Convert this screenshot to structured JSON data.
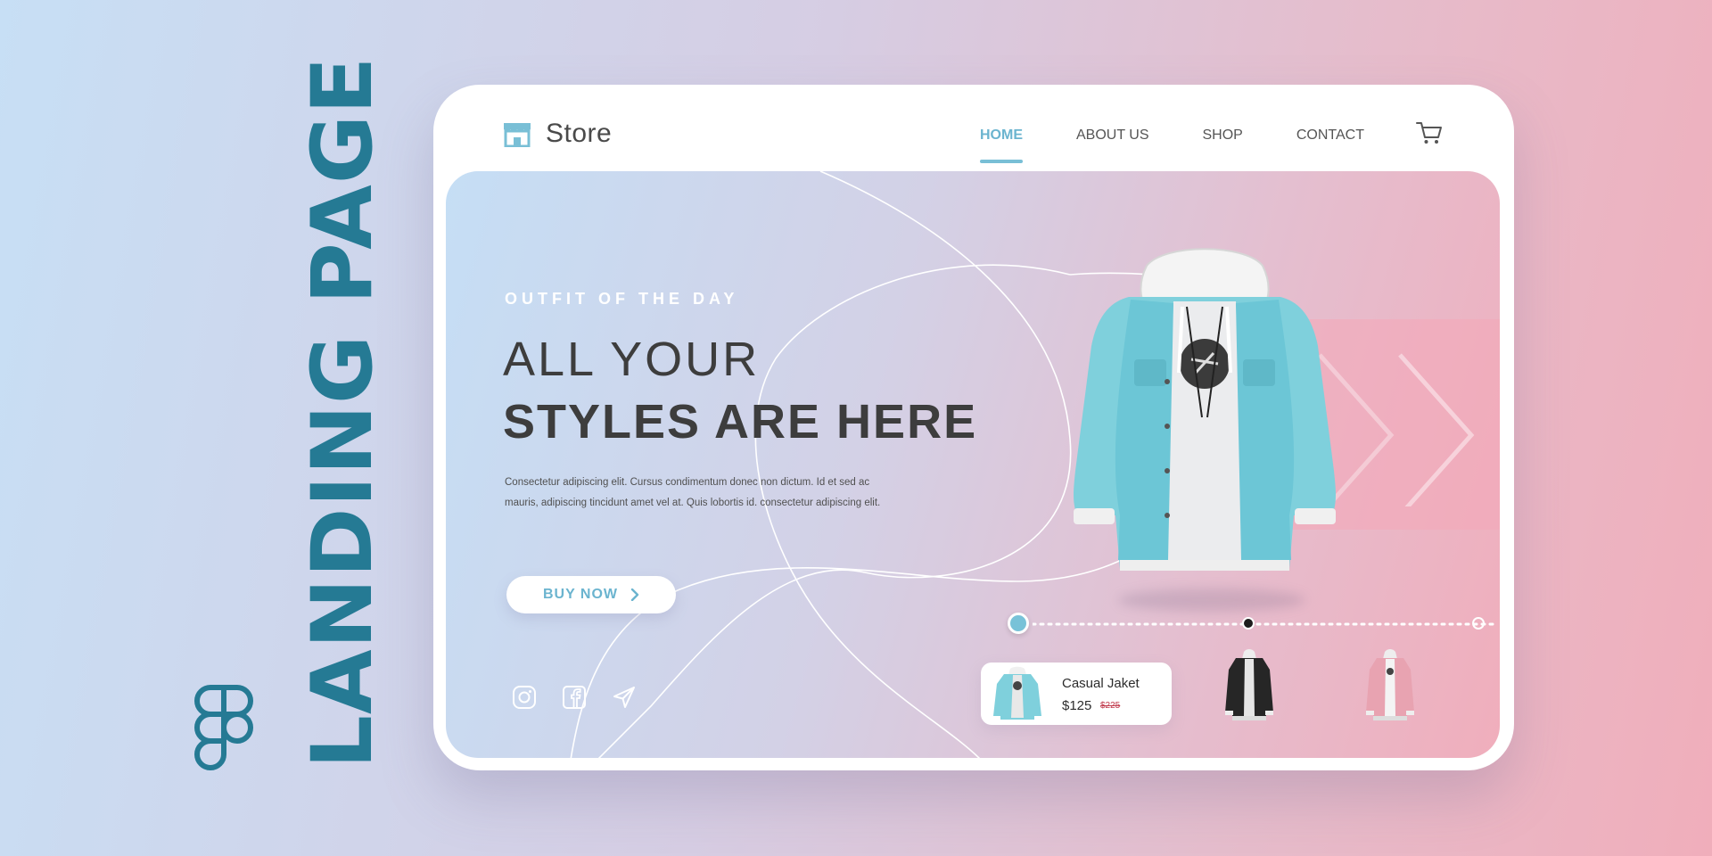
{
  "side_title": "LANDING PAGE",
  "brand": {
    "name": "Store",
    "icon": "storefront-icon"
  },
  "nav": {
    "items": [
      {
        "label": "HOME",
        "active": true
      },
      {
        "label": "ABOUT US",
        "active": false
      },
      {
        "label": "SHOP",
        "active": false
      },
      {
        "label": "CONTACT",
        "active": false
      }
    ],
    "cart_icon": "cart-icon"
  },
  "hero": {
    "kicker": "OUTFIT OF THE DAY",
    "headline_light": "ALL YOUR",
    "headline_bold": "STYLES ARE HERE",
    "description": "Consectetur adipiscing elit. Cursus condimentum donec non dictum. Id et sed ac mauris, adipiscing tincidunt amet vel at. Quis lobortis id. consectetur adipiscing elit.",
    "cta_label": "BUY NOW",
    "socials": [
      "instagram-icon",
      "facebook-icon",
      "send-icon"
    ]
  },
  "product": {
    "name": "Casual Jaket",
    "price": "$125",
    "old_price": "$225",
    "variants": [
      "blue",
      "black",
      "pink"
    ]
  },
  "colors": {
    "accent": "#6bb4cf",
    "brand_title": "#257a94",
    "text_dark": "#3d3d3d",
    "sale_red": "#c0394b"
  }
}
